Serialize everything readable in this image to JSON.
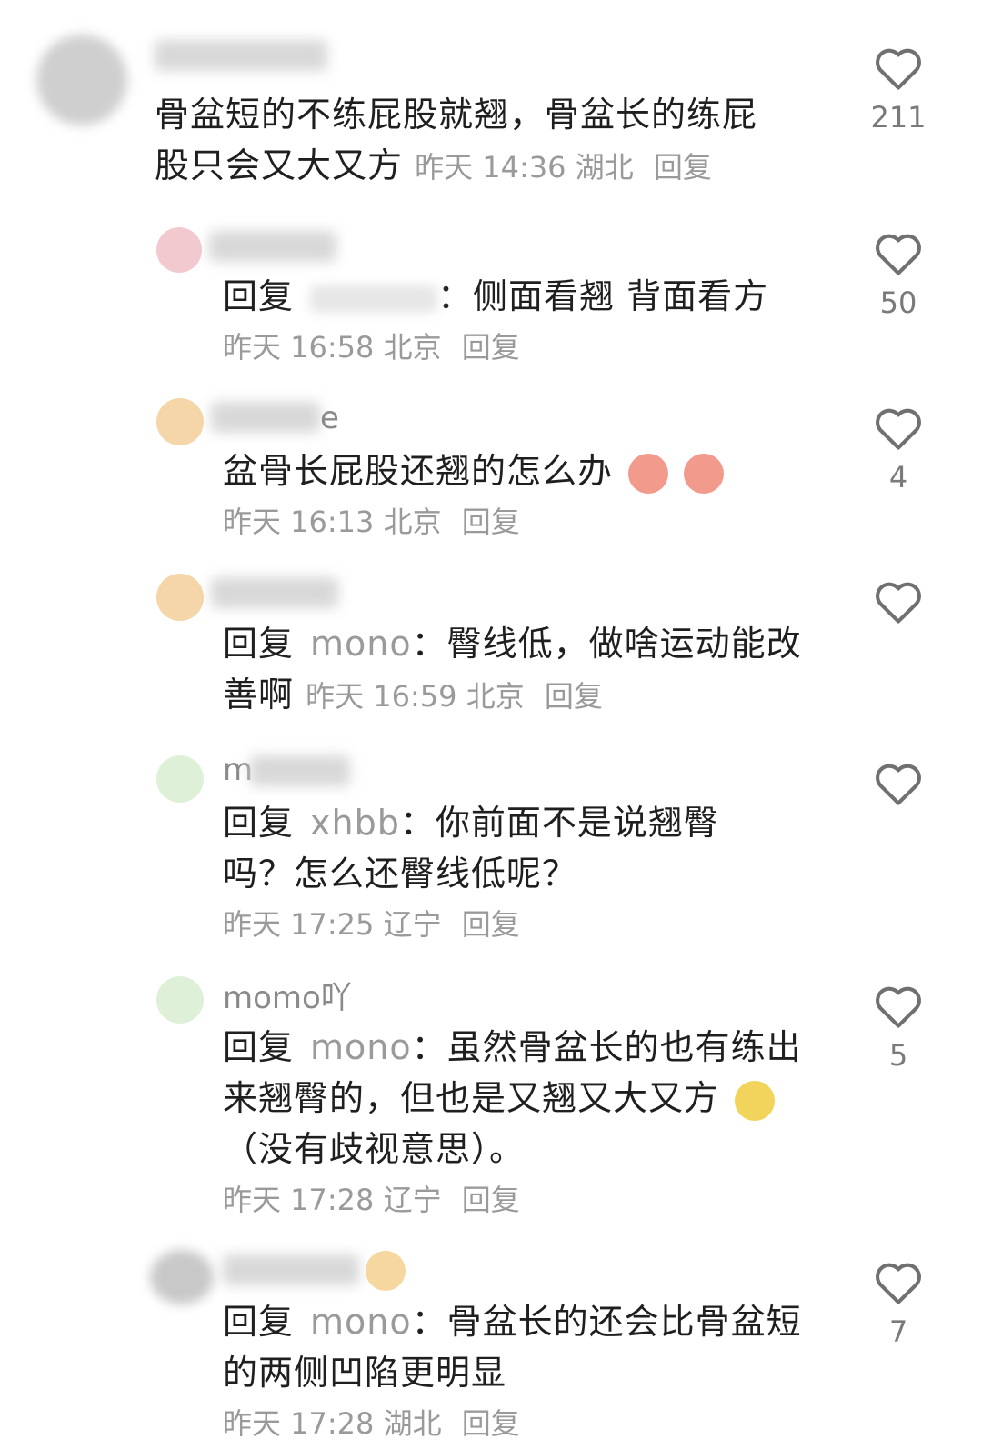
{
  "comments": [
    {
      "name_visible": "",
      "text": "骨盆短的不练屁股就翘，骨盆长的练屁股只会又大又方",
      "line1": "骨盆短的不练屁股就翘，骨盆长的练屁",
      "line2": "股只会又大又方",
      "time": "昨天 14:36",
      "location": "湖北",
      "reply_label": "回复",
      "likes": "211"
    },
    {
      "name_visible": "",
      "reply_prefix": "回复",
      "reply_to": "",
      "line1_rest": "：侧面看翘 背面看方",
      "time": "昨天 16:58",
      "location": "北京",
      "reply_label": "回复",
      "likes": "50"
    },
    {
      "name_visible": "e",
      "line1": "盆骨长屁股还翘的怎么办",
      "time": "昨天 16:13",
      "location": "北京",
      "reply_label": "回复",
      "likes": "4"
    },
    {
      "name_visible": "",
      "reply_prefix": "回复",
      "reply_to": "mono",
      "line1_rest": "：臀线低，做啥运动能改",
      "line2": "善啊",
      "time": "昨天 16:59",
      "location": "北京",
      "reply_label": "回复",
      "likes": ""
    },
    {
      "name_visible": "m",
      "reply_prefix": "回复",
      "reply_to": "xhbb",
      "line1_rest": "：你前面不是说翘臀",
      "line2": "吗？怎么还臀线低呢？",
      "time": "昨天 17:25",
      "location": "辽宁",
      "reply_label": "回复",
      "likes": ""
    },
    {
      "name_visible": "momo吖",
      "reply_prefix": "回复",
      "reply_to": "mono",
      "line1_rest": "：虽然骨盆长的也有练出",
      "line2": "来翘臀的，但也是又翘又大又方",
      "line3": "（没有歧视意思）。",
      "time": "昨天 17:28",
      "location": "辽宁",
      "reply_label": "回复",
      "likes": "5"
    },
    {
      "name_visible": "",
      "reply_prefix": "回复",
      "reply_to": "mono",
      "line1_rest": "：骨盆长的还会比骨盆短",
      "line2": "的两侧凹陷更明显",
      "time": "昨天 17:28",
      "location": "湖北",
      "reply_label": "回复",
      "likes": "7"
    }
  ],
  "colors": {
    "heart": "#707070",
    "meta": "#9a9a9a"
  },
  "icons": {
    "like": "heart-outline-icon"
  }
}
